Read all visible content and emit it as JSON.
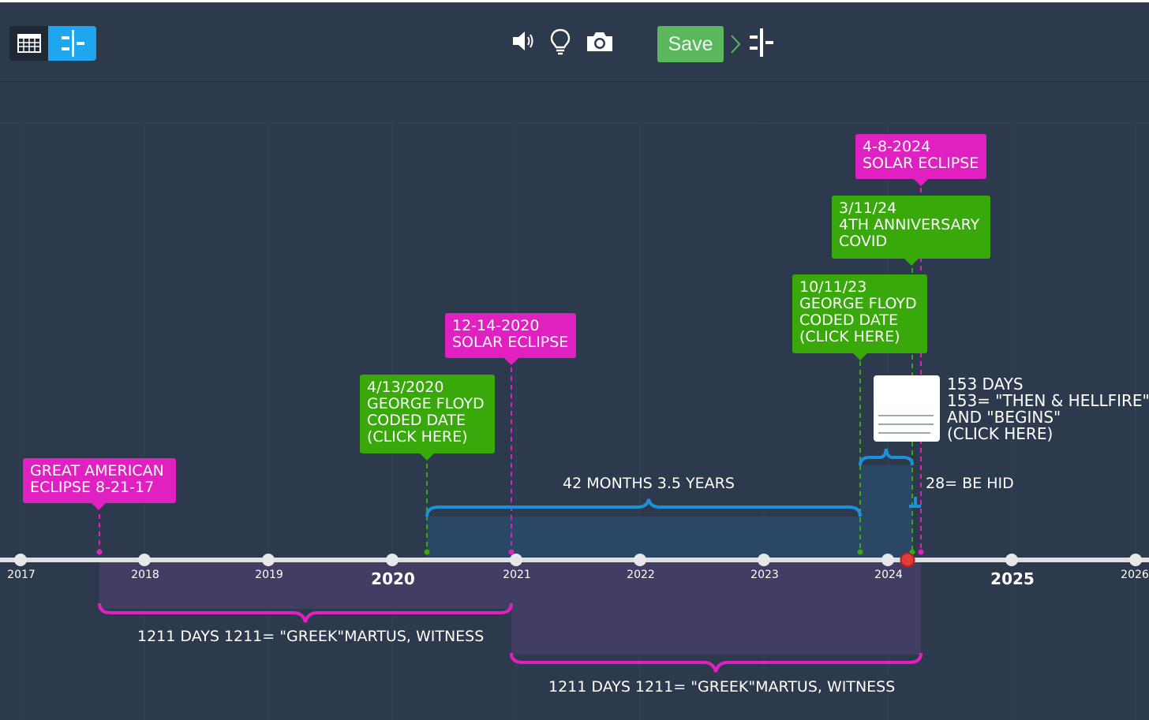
{
  "toolbar": {
    "save_label": "Save",
    "icons": [
      "table-view-icon",
      "timeline-view-icon",
      "speaker-icon",
      "lightbulb-icon",
      "camera-icon",
      "chevron-right-icon",
      "timeline-settings-icon"
    ]
  },
  "colors": {
    "background": "#2d3a4d",
    "accent_blue": "#1ea6f0",
    "save_green": "#5cb85c",
    "event_pink": "#e020c0",
    "event_green": "#38a80a",
    "span_blue": "#1e90d8",
    "span_magenta": "#e020c0"
  },
  "axis": {
    "years": [
      "2017",
      "2018",
      "2019",
      "2020",
      "2021",
      "2022",
      "2023",
      "2024",
      "2025",
      "2026"
    ],
    "major_years": [
      "2020",
      "2025"
    ]
  },
  "events": {
    "great_american": "GREAT AMERICAN\nECLIPSE 8-21-17",
    "floyd_2020": "4/13/2020\nGEORGE FLOYD\nCODED DATE\n(CLICK HERE)",
    "solar_2020": "12-14-2020\nSOLAR ECLIPSE",
    "floyd_2023": "10/11/23\nGEORGE FLOYD\nCODED DATE\n(CLICK HERE)",
    "covid_2024": "3/11/24\n4TH ANNIVERSARY\nCOVID",
    "solar_2024": "4-8-2024\nSOLAR ECLIPSE"
  },
  "spans": {
    "months_42": "42 MONTHS 3.5 YEARS",
    "days_153": "153 DAYS\n153= \"THEN & HELLFIRE\"\nAND \"BEGINS\"\n(CLICK HERE)",
    "be_hid": "28= BE HID",
    "days_1211_a": "1211 DAYS 1211= \"GREEK\"MARTUS, WITNESS",
    "days_1211_b": "1211 DAYS 1211= \"GREEK\"MARTUS, WITNESS"
  }
}
